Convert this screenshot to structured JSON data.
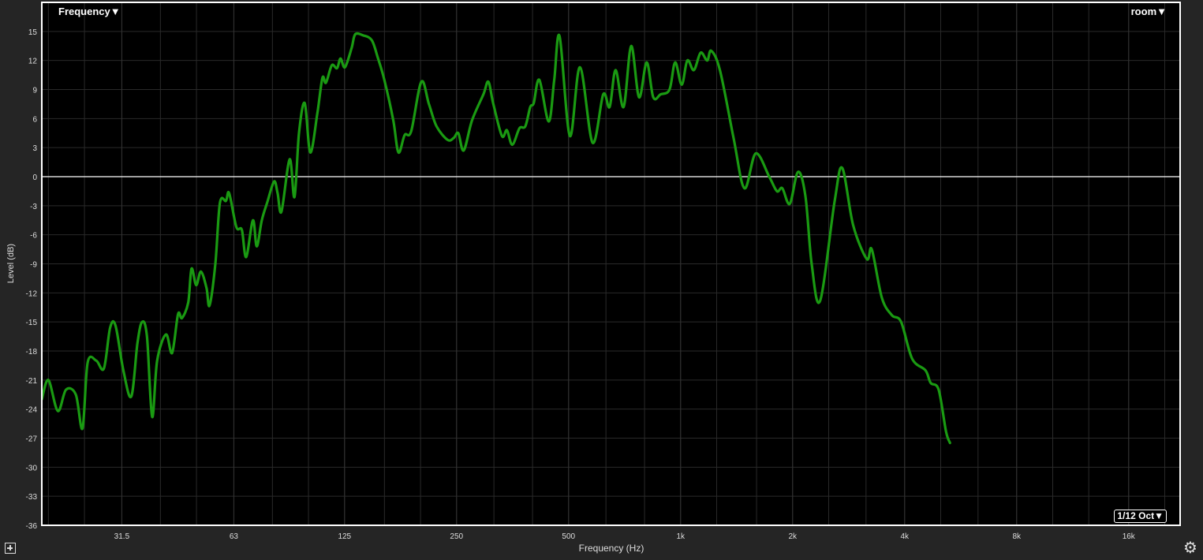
{
  "header": {
    "frequency_menu": "Frequency▼",
    "trace_menu": "room▼",
    "smoothing": "1/12 Oct▼"
  },
  "icons": {
    "add": "add-icon",
    "settings": "gear-icon"
  },
  "colors": {
    "background": "#000000",
    "frame": "#ffffff",
    "trace": "#1a9a12",
    "zero_line": "#ffffff",
    "grid": "#2a2a2a"
  },
  "chart_data": {
    "type": "line",
    "xlabel": "Frequency (Hz)",
    "ylabel": "Level (dB)",
    "xscale": "log",
    "xlim": [
      19.2,
      22000
    ],
    "ylim": [
      -36,
      18
    ],
    "grid": true,
    "x_tick_values": [
      31.5,
      63,
      125,
      250,
      500,
      1000,
      2000,
      4000,
      8000,
      16000
    ],
    "x_tick_labels": [
      "31.5",
      "63",
      "125",
      "250",
      "500",
      "1k",
      "2k",
      "4k",
      "8k",
      "16k"
    ],
    "y_ticks": [
      15,
      12,
      9,
      6,
      3,
      0,
      -3,
      -6,
      -9,
      -12,
      -15,
      -18,
      -21,
      -24,
      -27,
      -30,
      -33,
      -36
    ],
    "series": [
      {
        "color": "#1a9a12",
        "points": [
          [
            19.2,
            -23
          ],
          [
            20.0,
            -21
          ],
          [
            21.2,
            -24.2
          ],
          [
            22.3,
            -22
          ],
          [
            23.7,
            -22.5
          ],
          [
            24.7,
            -26
          ],
          [
            25.5,
            -19.2
          ],
          [
            26.9,
            -19
          ],
          [
            28.2,
            -19.8
          ],
          [
            29.3,
            -15.6
          ],
          [
            30.3,
            -15.4
          ],
          [
            31.8,
            -20
          ],
          [
            33.4,
            -22.7
          ],
          [
            34.7,
            -17.2
          ],
          [
            35.7,
            -15
          ],
          [
            36.8,
            -16.5
          ],
          [
            38.0,
            -24.8
          ],
          [
            39.2,
            -19
          ],
          [
            41.4,
            -16.3
          ],
          [
            43.0,
            -18.2
          ],
          [
            44.6,
            -14.2
          ],
          [
            45.7,
            -14.6
          ],
          [
            47.5,
            -13
          ],
          [
            48.5,
            -9.5
          ],
          [
            49.9,
            -11.2
          ],
          [
            51.4,
            -9.8
          ],
          [
            53.2,
            -11.5
          ],
          [
            54.2,
            -13.3
          ],
          [
            56.2,
            -9
          ],
          [
            57.8,
            -2.7
          ],
          [
            60.0,
            -2.5
          ],
          [
            61.2,
            -1.7
          ],
          [
            64.0,
            -5.2
          ],
          [
            66.2,
            -5.5
          ],
          [
            68.0,
            -8.3
          ],
          [
            70.9,
            -4.5
          ],
          [
            72.6,
            -7.2
          ],
          [
            74.9,
            -4.5
          ],
          [
            77.4,
            -2.7
          ],
          [
            80.8,
            -0.5
          ],
          [
            82.6,
            -1.7
          ],
          [
            84.6,
            -3.6
          ],
          [
            89.0,
            1.8
          ],
          [
            91.7,
            -2.1
          ],
          [
            94.3,
            4.5
          ],
          [
            97.7,
            7.6
          ],
          [
            101.1,
            2.5
          ],
          [
            105.6,
            6.5
          ],
          [
            109.0,
            10.2
          ],
          [
            111.4,
            9.7
          ],
          [
            115.5,
            11.5
          ],
          [
            119.3,
            11.2
          ],
          [
            121.9,
            12.2
          ],
          [
            125.3,
            11.3
          ],
          [
            130.6,
            13.3
          ],
          [
            133.5,
            14.7
          ],
          [
            140.0,
            14.6
          ],
          [
            147.9,
            14.1
          ],
          [
            153.5,
            12.3
          ],
          [
            159.9,
            10
          ],
          [
            169.0,
            5.8
          ],
          [
            174.5,
            2.5
          ],
          [
            181.3,
            4.3
          ],
          [
            188.8,
            4.7
          ],
          [
            201.0,
            9.8
          ],
          [
            210.7,
            7.5
          ],
          [
            220.9,
            5.2
          ],
          [
            236.5,
            3.8
          ],
          [
            245.7,
            4
          ],
          [
            252.7,
            4.5
          ],
          [
            261.3,
            2.7
          ],
          [
            275.0,
            5.8
          ],
          [
            295.1,
            8.5
          ],
          [
            304.4,
            9.8
          ],
          [
            313.9,
            7.5
          ],
          [
            331.0,
            4.2
          ],
          [
            341.4,
            4.8
          ],
          [
            352.9,
            3.3
          ],
          [
            369.0,
            5
          ],
          [
            382.5,
            5.2
          ],
          [
            394.5,
            7.2
          ],
          [
            403.0,
            7.6
          ],
          [
            417.2,
            10
          ],
          [
            442.1,
            5.7
          ],
          [
            457.6,
            10
          ],
          [
            472.9,
            14.5
          ],
          [
            503.9,
            4.2
          ],
          [
            536.6,
            11.3
          ],
          [
            580.1,
            3.5
          ],
          [
            619.5,
            8.5
          ],
          [
            644.4,
            7.2
          ],
          [
            669.0,
            11
          ],
          [
            702.8,
            7.2
          ],
          [
            736.6,
            13.5
          ],
          [
            773.3,
            8.2
          ],
          [
            810.9,
            11.8
          ],
          [
            844.4,
            8.2
          ],
          [
            884.0,
            8.5
          ],
          [
            933.7,
            9
          ],
          [
            966.9,
            11.8
          ],
          [
            1006.9,
            9.5
          ],
          [
            1042.6,
            12
          ],
          [
            1085.7,
            11
          ],
          [
            1132.2,
            12.8
          ],
          [
            1178.8,
            12
          ],
          [
            1207.9,
            13
          ],
          [
            1275.6,
            11
          ],
          [
            1388.0,
            4
          ],
          [
            1484.5,
            -1.2
          ],
          [
            1591.7,
            2.4
          ],
          [
            1730.5,
            0
          ],
          [
            1814.7,
            -1.5
          ],
          [
            1876.7,
            -1.2
          ],
          [
            1965.2,
            -2.8
          ],
          [
            2067.4,
            0.5
          ],
          [
            2164.7,
            -2
          ],
          [
            2249.7,
            -9
          ],
          [
            2371.6,
            -12.8
          ],
          [
            2595.0,
            -2.5
          ],
          [
            2719.8,
            0.9
          ],
          [
            2908.4,
            -5
          ],
          [
            3164.2,
            -8.5
          ],
          [
            3264.6,
            -7.5
          ],
          [
            3474.1,
            -12.5
          ],
          [
            3696.6,
            -14.3
          ],
          [
            3914.4,
            -15
          ],
          [
            4191.5,
            -18.8
          ],
          [
            4550.4,
            -20
          ],
          [
            4700.0,
            -21.3
          ],
          [
            4937.4,
            -22
          ],
          [
            5165.7,
            -26.3
          ],
          [
            5298.0,
            -27.5
          ]
        ]
      }
    ]
  }
}
